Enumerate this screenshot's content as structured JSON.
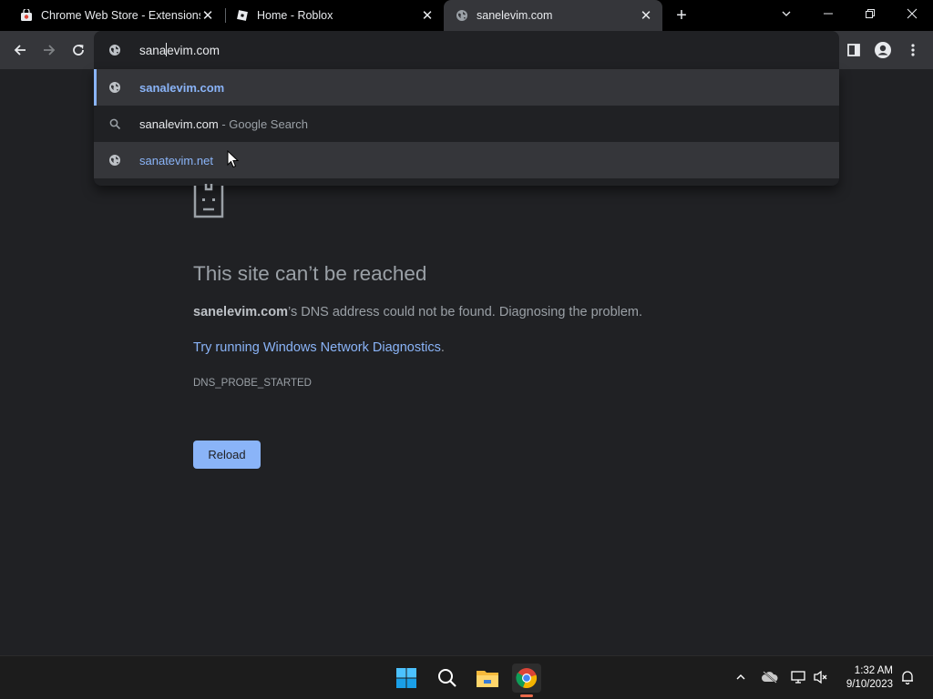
{
  "tabs": [
    {
      "title": "Chrome Web Store - Extensions",
      "favicon": "chrome-web-store-icon",
      "active": false
    },
    {
      "title": "Home - Roblox",
      "favicon": "roblox-icon",
      "active": false
    },
    {
      "title": "sanelevim.com",
      "favicon": "globe-icon",
      "active": true
    }
  ],
  "omnibox": {
    "typed_before_caret": "sana",
    "typed_after_caret": "evim.com"
  },
  "suggestions": [
    {
      "icon": "globe-icon",
      "text": "sanalevim.com",
      "suffix": ""
    },
    {
      "icon": "search-icon",
      "text": "sanalevim.com",
      "suffix": " - Google Search"
    },
    {
      "icon": "globe-icon",
      "text": "sanatevim.net",
      "suffix": ""
    }
  ],
  "error_page": {
    "title": "This site can’t be reached",
    "host": "sanelevim.com",
    "message": "’s DNS address could not be found. Diagnosing the problem.",
    "diagnostics_link": "Try running Windows Network Diagnostics",
    "diagnostics_period": ".",
    "error_code": "DNS_PROBE_STARTED",
    "reload_label": "Reload"
  },
  "taskbar": {
    "time": "1:32 AM",
    "date": "9/10/2023"
  },
  "colors": {
    "accent_blue": "#8ab4f8",
    "page_bg": "#202124",
    "toolbar_bg": "#35363a"
  }
}
